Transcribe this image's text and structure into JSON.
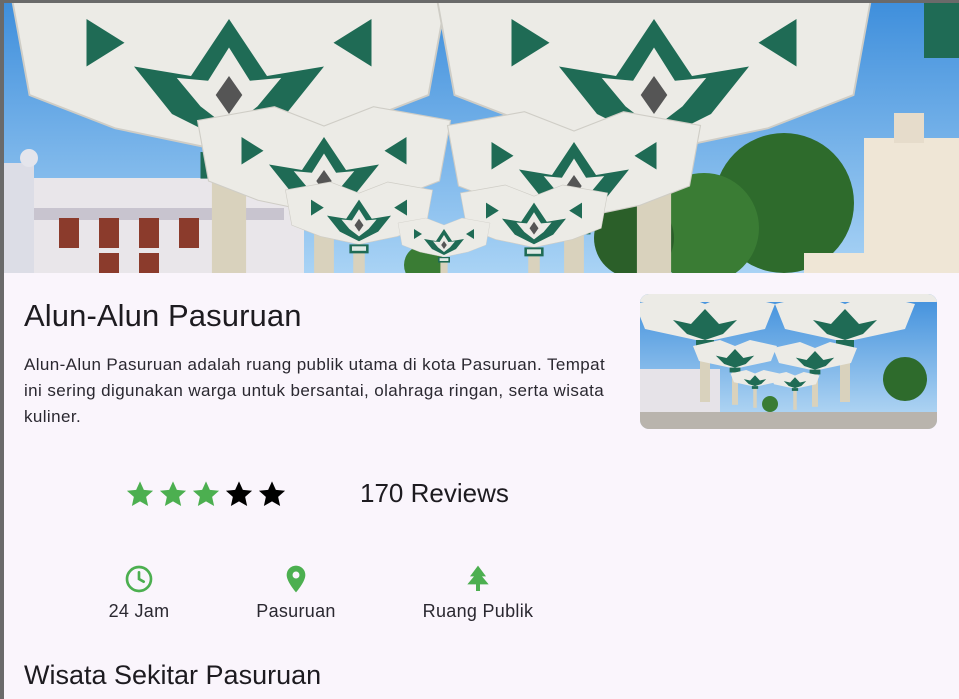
{
  "place": {
    "title": "Alun-Alun Pasuruan",
    "description": "Alun-Alun Pasuruan adalah ruang publik utama di kota Pasuruan. Tempat ini sering digunakan warga untuk bersantai, olahraga ringan, serta wisata kuliner."
  },
  "rating": {
    "value": 3,
    "max": 5,
    "reviews_label": "170 Reviews",
    "filled_color": "#4caf50",
    "empty_color": "#000000"
  },
  "info": [
    {
      "icon": "clock-icon",
      "label": "24 Jam"
    },
    {
      "icon": "location-pin-icon",
      "label": "Pasuruan"
    },
    {
      "icon": "tree-icon",
      "label": "Ruang Publik"
    }
  ],
  "accent_color": "#4caf50",
  "section": {
    "title": "Wisata Sekitar Pasuruan"
  }
}
